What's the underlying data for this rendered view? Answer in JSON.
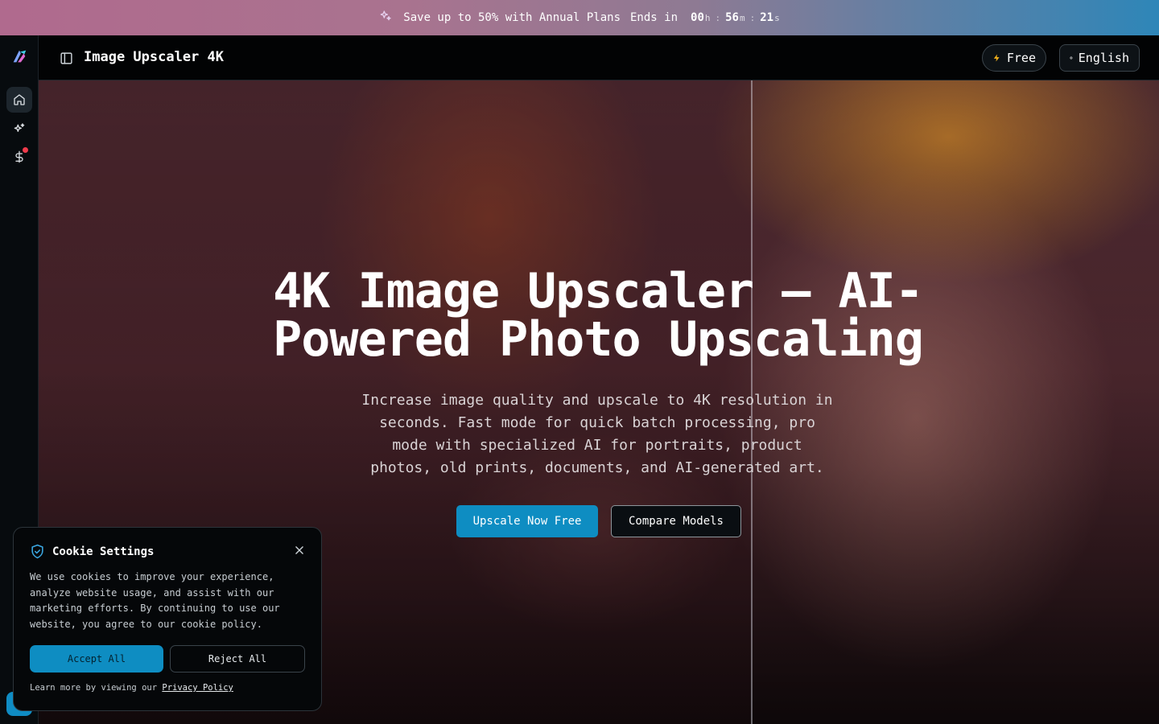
{
  "promo": {
    "message": "Save up to 50% with Annual Plans",
    "ends_label": "Ends in",
    "countdown": {
      "hours": "00",
      "hours_unit": "h",
      "minutes": "56",
      "minutes_unit": "m",
      "seconds": "21",
      "seconds_unit": "s",
      "separator": ":"
    }
  },
  "header": {
    "title": "Image Upscaler 4K",
    "plan_label": "Free",
    "language_label": "English"
  },
  "sidebar": {
    "items": [
      {
        "name": "home",
        "icon": "home-icon",
        "active": true
      },
      {
        "name": "ai-tools",
        "icon": "sparkles-icon",
        "active": false
      },
      {
        "name": "pricing",
        "icon": "dollar-icon",
        "active": false,
        "notification": true
      }
    ]
  },
  "hero": {
    "title_line1": "4K Image Upscaler — AI-",
    "title_line2": "Powered Photo Upscaling",
    "subtitle": "Increase image quality and upscale to 4K resolution in seconds. Fast mode for quick batch processing, pro mode with specialized AI for portraits, product photos, old prints, documents, and AI-generated art.",
    "primary_cta": "Upscale Now Free",
    "secondary_cta": "Compare Models"
  },
  "cookie": {
    "title": "Cookie Settings",
    "body": "We use cookies to improve your experience, analyze website usage, and assist with our marketing efforts. By continuing to use our website, you agree to our cookie policy.",
    "accept_label": "Accept All",
    "reject_label": "Reject All",
    "footer_prefix": "Learn more by viewing our",
    "policy_link": "Privacy Policy"
  },
  "colors": {
    "accent": "#0e8dc2",
    "notification": "#ef3b4b",
    "banner_start": "#b06a8e",
    "banner_end": "#2e86b8"
  }
}
